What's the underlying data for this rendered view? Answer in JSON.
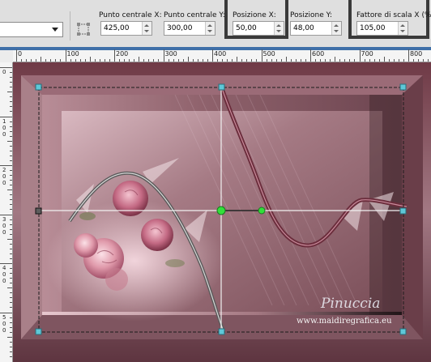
{
  "toolbar": {
    "centerX": {
      "label": "Punto centrale X:",
      "value": "425,00"
    },
    "centerY": {
      "label": "Punto centrale Y:",
      "value": "300,00"
    },
    "posX": {
      "label": "Posizione X:",
      "value": "50,00"
    },
    "posY": {
      "label": "Posizione Y:",
      "value": "48,00"
    },
    "scaleX": {
      "label": "Fattore di scala X (%)",
      "value": "105,00"
    }
  },
  "ruler": {
    "h_labels": [
      "0",
      "100",
      "200",
      "300",
      "400",
      "500",
      "600",
      "700",
      "800"
    ],
    "v_labels": [
      "0",
      "100",
      "200",
      "300",
      "400",
      "500"
    ]
  },
  "watermark": {
    "signature": "Pinuccia",
    "site": "www.maidiregrafica.eu"
  },
  "colors": {
    "workspace": "#3f6fa8",
    "frame_dark": "#5a2c36",
    "frame_light": "#c9a2ac",
    "inner_panel": "#8e5f69",
    "highlight_box": "#3a3a3a",
    "handle_cyan": "#5ec8d8",
    "handle_green": "#32e03a"
  }
}
